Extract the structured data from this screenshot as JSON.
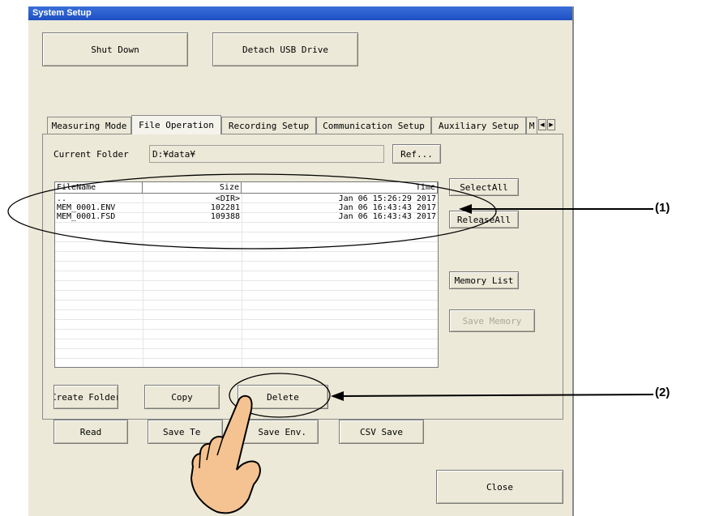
{
  "window": {
    "title": "System Setup"
  },
  "top_buttons": {
    "shut_down": "Shut Down",
    "detach_usb": "Detach USB Drive"
  },
  "tabs": [
    {
      "label": "Measuring Mode"
    },
    {
      "label": "File Operation"
    },
    {
      "label": "Recording Setup"
    },
    {
      "label": "Communication Setup"
    },
    {
      "label": "Auxiliary Setup"
    },
    {
      "label": "M"
    }
  ],
  "tab_scroll": {
    "left": "◀",
    "right": "▶"
  },
  "folder": {
    "label": "Current Folder",
    "path": "D:¥data¥",
    "ref_button": "Ref..."
  },
  "file_list": {
    "columns": [
      "FileName",
      "Size",
      "Time"
    ],
    "rows": [
      {
        "name": "..",
        "size": "<DIR>",
        "time": "Jan 06 15:26:29 2017"
      },
      {
        "name": "MEM_0001.ENV",
        "size": "102281",
        "time": "Jan 06 16:43:43 2017"
      },
      {
        "name": "MEM_0001.FSD",
        "size": "109388",
        "time": "Jan 06 16:43:43 2017"
      }
    ]
  },
  "side_buttons": {
    "select_all": "SelectAll",
    "release_all": "ReleaseAll",
    "memory_list": "Memory List",
    "save_memory": "Save Memory"
  },
  "actions": {
    "create_folder": "Create Folder",
    "copy": "Copy",
    "delete": "Delete",
    "read": "Read",
    "save_te": "Save Te",
    "save_env": "Save Env.",
    "csv_save": "CSV Save"
  },
  "close_button": "Close",
  "callouts": {
    "one": "(1)",
    "two": "(2)"
  }
}
